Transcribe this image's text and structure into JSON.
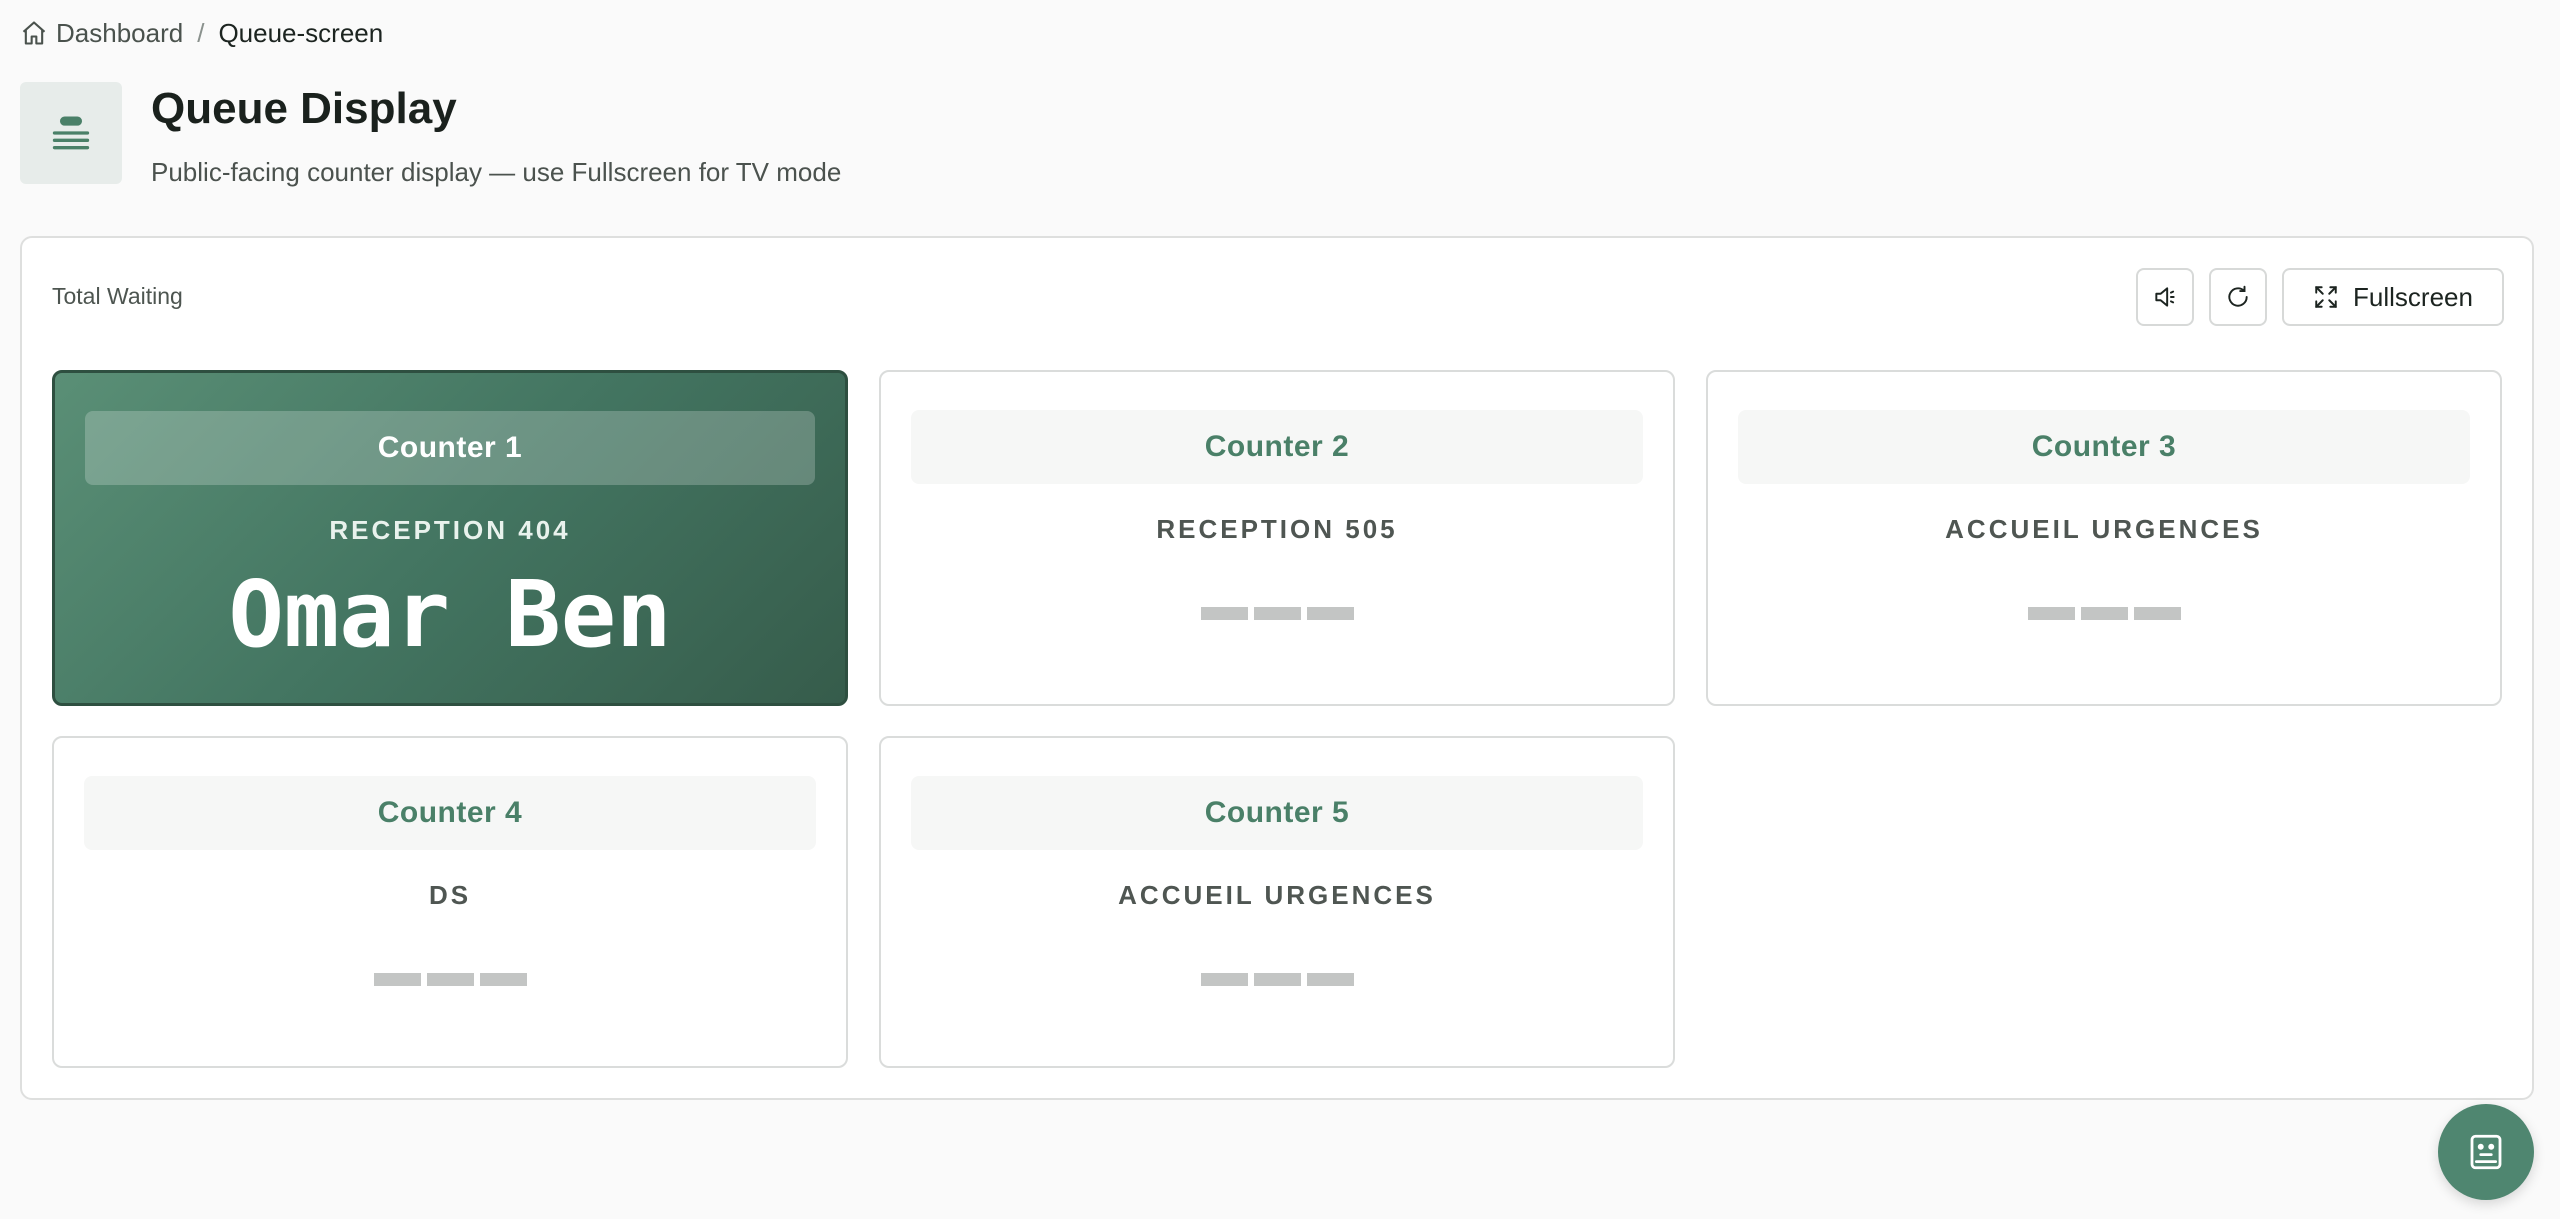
{
  "breadcrumb": {
    "home_label": "Dashboard",
    "separator": "/",
    "current": "Queue-screen"
  },
  "header": {
    "title": "Queue Display",
    "subtitle": "Public-facing counter display — use Fullscreen for TV mode"
  },
  "panel": {
    "label": "Total Waiting",
    "fullscreen_label": "Fullscreen"
  },
  "counters": [
    {
      "name": "Counter 1",
      "room": "RECEPTION 404",
      "patient": "Omar Ben",
      "active": true
    },
    {
      "name": "Counter 2",
      "room": "RECEPTION 505",
      "patient": "",
      "active": false
    },
    {
      "name": "Counter 3",
      "room": "ACCUEIL URGENCES",
      "patient": "",
      "active": false
    },
    {
      "name": "Counter 4",
      "room": "DS",
      "patient": "",
      "active": false
    },
    {
      "name": "Counter 5",
      "room": "ACCUEIL URGENCES",
      "patient": "",
      "active": false
    }
  ],
  "colors": {
    "accent": "#4a8068",
    "active_card": "#437561",
    "fab": "#4f8670"
  },
  "icons": {
    "home": "home-icon",
    "header": "queue-list-icon",
    "sound": "speaker-icon",
    "refresh": "refresh-icon",
    "fullscreen": "expand-icon",
    "fab": "assistant-bot-icon"
  }
}
